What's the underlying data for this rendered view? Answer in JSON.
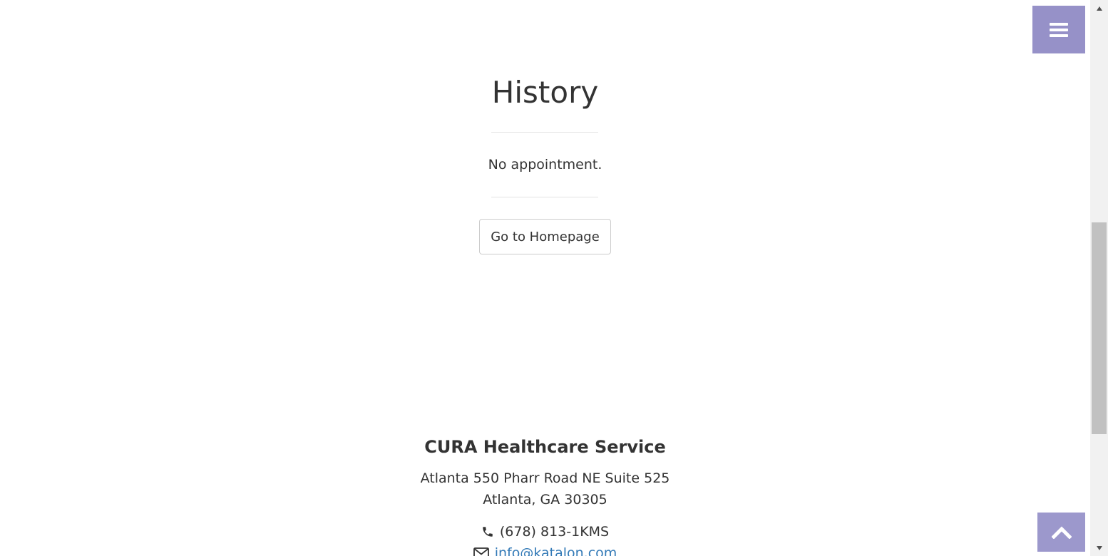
{
  "nav": {
    "menu_icon": "bars-icon",
    "scroll_top_icon": "chevron-up-icon"
  },
  "history": {
    "title": "History",
    "empty_message": "No appointment.",
    "homepage_button_label": "Go to Homepage"
  },
  "footer": {
    "company_name": "CURA Healthcare Service",
    "address_line1": "Atlanta 550 Pharr Road NE Suite 525",
    "address_line2": "Atlanta, GA 30305",
    "phone": "(678) 813-1KMS",
    "phone_icon": "phone-icon",
    "email": "info@katalon.com",
    "email_icon": "envelope-icon"
  },
  "colors": {
    "menu_button": "#9691c8",
    "scroll_top_button": "#9c98cc",
    "link": "#337ab7",
    "text": "#333333"
  }
}
